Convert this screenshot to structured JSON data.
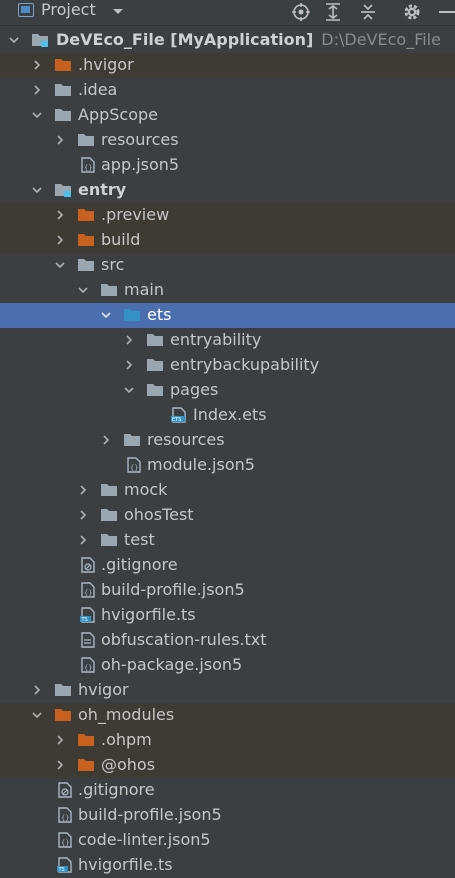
{
  "header": {
    "title": "Project",
    "tools": [
      "locate-icon",
      "expand-all-icon",
      "collapse-all-icon",
      "settings-icon",
      "hide-icon"
    ]
  },
  "colors": {
    "folder_gray": "#9aa7b0",
    "folder_orange": "#c8611f",
    "folder_blue": "#3592c4",
    "module_accent": "#4fc1e9",
    "selection": "#4b6eaf",
    "highlight": "#3d3b34"
  },
  "tree": {
    "root": {
      "label": "DeVEco_File",
      "module": "[MyApplication]",
      "path": "D:\\DeVEco_File"
    },
    "items": [
      {
        "label": ".hvigor"
      },
      {
        "label": ".idea"
      },
      {
        "label": "AppScope"
      },
      {
        "label": "resources"
      },
      {
        "label": "app.json5"
      },
      {
        "label": "entry"
      },
      {
        "label": ".preview"
      },
      {
        "label": "build"
      },
      {
        "label": "src"
      },
      {
        "label": "main"
      },
      {
        "label": "ets"
      },
      {
        "label": "entryability"
      },
      {
        "label": "entrybackupability"
      },
      {
        "label": "pages"
      },
      {
        "label": "Index.ets"
      },
      {
        "label": "resources"
      },
      {
        "label": "module.json5"
      },
      {
        "label": "mock"
      },
      {
        "label": "ohosTest"
      },
      {
        "label": "test"
      },
      {
        "label": ".gitignore"
      },
      {
        "label": "build-profile.json5"
      },
      {
        "label": "hvigorfile.ts"
      },
      {
        "label": "obfuscation-rules.txt"
      },
      {
        "label": "oh-package.json5"
      },
      {
        "label": "hvigor"
      },
      {
        "label": "oh_modules"
      },
      {
        "label": ".ohpm"
      },
      {
        "label": "@ohos"
      },
      {
        "label": ".gitignore"
      },
      {
        "label": "build-profile.json5"
      },
      {
        "label": "code-linter.json5"
      },
      {
        "label": "hvigorfile.ts"
      }
    ]
  }
}
